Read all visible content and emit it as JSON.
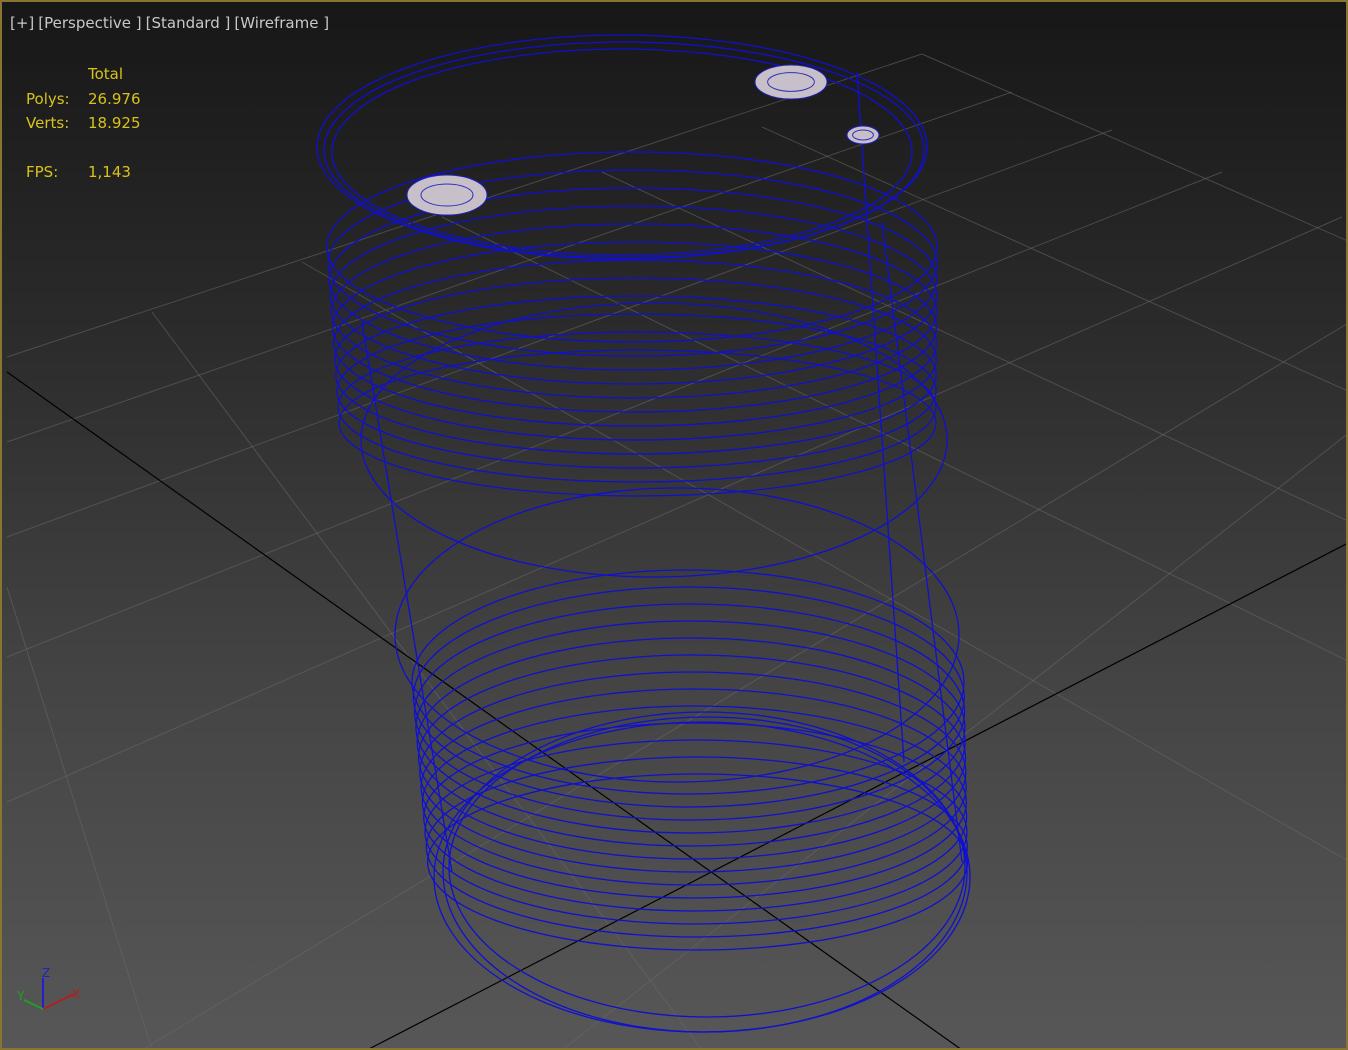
{
  "viewport": {
    "menu_label": "[+]",
    "view_label": "[Perspective ]",
    "shading_label": "[Standard ]",
    "mode_label": "[Wireframe ]"
  },
  "stats": {
    "header": "Total",
    "polys_label": "Polys:",
    "polys_value": "26.976",
    "verts_label": "Verts:",
    "verts_value": "18.925",
    "fps_label": "FPS:",
    "fps_value": "1,143"
  },
  "gizmo": {
    "x": "X",
    "y": "Y",
    "z": "Z"
  },
  "colors": {
    "wire": "#1010d0",
    "stats": "#d8c21c",
    "border": "#8a7433",
    "x_axis": "#c02020",
    "y_axis": "#20a020",
    "z_axis": "#2020d0"
  }
}
